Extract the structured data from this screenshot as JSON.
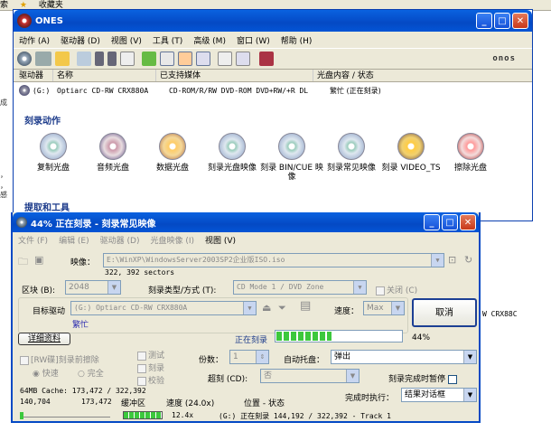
{
  "bg": {
    "items": [
      "索",
      "收藏夹"
    ],
    "left_texts": [
      "成",
      "，",
      "，",
      "感"
    ]
  },
  "ones": {
    "title": "ONES",
    "menu": [
      "动作 (A)",
      "驱动器 (D)",
      "视图 (V)",
      "工具 (T)",
      "高级 (M)",
      "窗口 (W)",
      "帮助 (H)"
    ],
    "brand": "onos",
    "cols": [
      "驱动器",
      "名称",
      "已支持媒体",
      "光盘内容 / 状态"
    ],
    "row": {
      "drive": "(G:)",
      "name": "Optiarc CD-RW CRX880A",
      "media": "CD-ROM/R/RW DVD-ROM DVD+RW/+R DL",
      "status": "繁忙 (正在刻录)"
    },
    "section1": "刻录动作",
    "actions": [
      "复制光盘",
      "音频光盘",
      "数据光盘",
      "刻录光盘映像",
      "刻录 BIN/CUE 映像",
      "刻录常见映像",
      "刻录 VIDEO_TS",
      "擦除光盘"
    ],
    "section2": "提取和工具",
    "right_clip": "W CRX88C"
  },
  "burn": {
    "title": "44% 正在刻录 - 刻录常见映像",
    "menu": [
      "文件 (F)",
      "编辑 (E)",
      "驱动器 (D)",
      "光盘映像 (I)",
      "视图 (V)"
    ],
    "image_label": "映像：",
    "image_path": "E:\\WinXP\\WindowsServer2003SP2企业版ISO.iso",
    "sectors": "322, 392 sectors",
    "block_label": "区块 (B):",
    "block_value": "2048",
    "type_label": "刻录类型/方式 (T):",
    "type_value": "CD Mode 1 / DVD Zone",
    "close_label": "关闭 (C)",
    "target_label": "目标驱动",
    "target_value": "(G:) Optiarc CD-RW CRX880A",
    "speed_label": "速度：",
    "speed_value": "Max",
    "cancel": "取消",
    "busy": "繁忙",
    "details": "详细资料",
    "status_text": "正在刻录",
    "progress": 0.44,
    "percent": "44%",
    "rw_erase": "[RW碟]刻录前擦除",
    "quick": "快速",
    "full": "完全",
    "test": "测试",
    "burn": "刻录",
    "verify": "校验",
    "copies_label": "份数：",
    "copies_value": "1",
    "auto_tray_label": "自动托盘：",
    "auto_tray_value": "弹出",
    "overburn_label": "超刻 (CD):",
    "overburn_value": "否",
    "pause_label": "刻录完成时暂停",
    "cache_label": "64MB Cache: 173,472 / 322,392",
    "finish_label": "完成时执行：",
    "finish_value": "结果对话框",
    "buf1": "140,704",
    "buf2": "173,472",
    "buf_label": "缓冲区",
    "speed_hdr": "速度 (24.0x)",
    "pos_hdr": "位置 - 状态",
    "speed_now": "12.4x",
    "pos_status": "(G:) 正在刻录 144,192 / 322,392 - Track 1"
  },
  "colors": {
    "xp_blue": "#0449c4",
    "progress": "#3cc83c",
    "bg": "#ece9d8",
    "section": "#1b3a8a"
  }
}
